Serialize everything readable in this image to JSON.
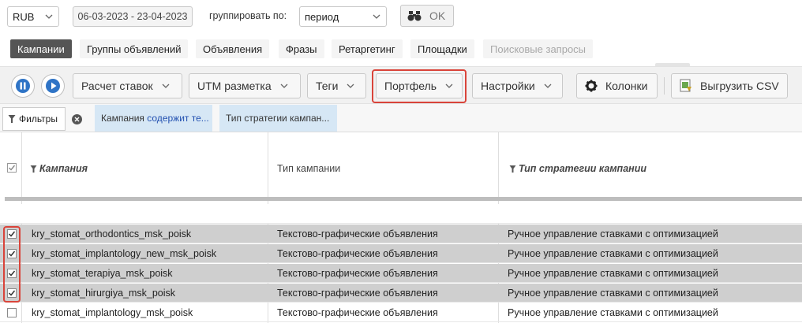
{
  "filters": {
    "currency": "RUB",
    "date_range": "06-03-2023 - 23-04-2023",
    "group_by_label": "группировать по:",
    "group_by_value": "период",
    "ok_label": "OK"
  },
  "tabs": [
    {
      "label": "Кампании",
      "state": "active"
    },
    {
      "label": "Группы объявлений",
      "state": "normal"
    },
    {
      "label": "Объявления",
      "state": "normal"
    },
    {
      "label": "Фразы",
      "state": "normal"
    },
    {
      "label": "Ретаргетинг",
      "state": "normal"
    },
    {
      "label": "Площадки",
      "state": "normal"
    },
    {
      "label": "Поисковые запросы",
      "state": "disabled"
    }
  ],
  "toolbar": {
    "bid_calc": "Расчет ставок",
    "utm": "UTM разметка",
    "tags": "Теги",
    "portfolio": "Портфель",
    "settings": "Настройки",
    "columns": "Колонки",
    "export": "Выгрузить CSV"
  },
  "filterbar": {
    "label": "Фильтры",
    "chip1_prefix": "Кампания",
    "chip1_keyword": "содержит те...",
    "chip2": "Тип стратегии кампан..."
  },
  "table": {
    "headers": {
      "campaign": "Кампания",
      "type": "Тип кампании",
      "strategy": "Тип стратегии кампании"
    },
    "rows": [
      {
        "campaign": "kry_stomat_orthodontics_msk_poisk",
        "type": "Текстово-графические объявления",
        "strategy": "Ручное управление ставками с оптимизацией",
        "checked": true
      },
      {
        "campaign": "kry_stomat_implantology_new_msk_poisk",
        "type": "Текстово-графические объявления",
        "strategy": "Ручное управление ставками с оптимизацией",
        "checked": true
      },
      {
        "campaign": "kry_stomat_terapiya_msk_poisk",
        "type": "Текстово-графические объявления",
        "strategy": "Ручное управление ставками с оптимизацией",
        "checked": true
      },
      {
        "campaign": "kry_stomat_hirurgiya_msk_poisk",
        "type": "Текстово-графические объявления",
        "strategy": "Ручное управление ставками с оптимизацией",
        "checked": true
      },
      {
        "campaign": "kry_stomat_implantology_msk_poisk",
        "type": "Текстово-графические объявления",
        "strategy": "Ручное управление ставками с оптимизацией",
        "checked": false
      }
    ]
  },
  "colors": {
    "highlight": "#d9443a",
    "active_tab": "#555555",
    "chip": "#d6e7f5",
    "selected_row": "#cfcfcf",
    "play_blue": "#2f74c6"
  }
}
